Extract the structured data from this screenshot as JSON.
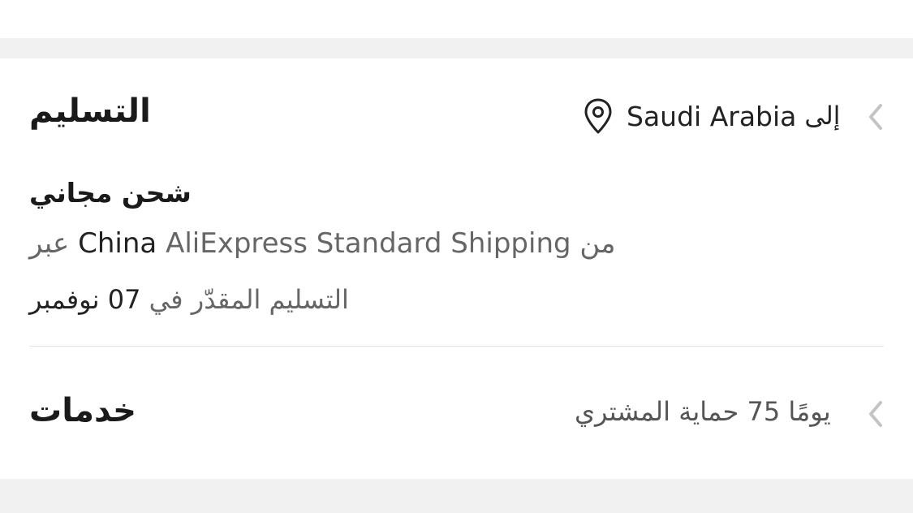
{
  "delivery": {
    "title": "التسليم",
    "destination_prefix": "إلى",
    "destination_country": "Saudi Arabia",
    "shipping_title": "شحن مجاني",
    "via_label": "عبر",
    "origin_country": "China",
    "carrier": "AliExpress Standard Shipping",
    "from_label": "من",
    "estimate_label": "التسليم المقدّر في",
    "estimate_day": "07",
    "estimate_month": "نوفمبر"
  },
  "services": {
    "title": "خدمات",
    "protection_prefix": "حماية المشتري",
    "protection_days": "75",
    "protection_suffix": "يومًا"
  },
  "icons": {
    "location": "location-pin-icon",
    "chevron": "chevron-left-icon"
  },
  "colors": {
    "background": "#ffffff",
    "section_separator": "#f1f1f1",
    "primary_text": "#222222",
    "secondary_text": "#666666",
    "chevron": "#c4c4c4"
  }
}
